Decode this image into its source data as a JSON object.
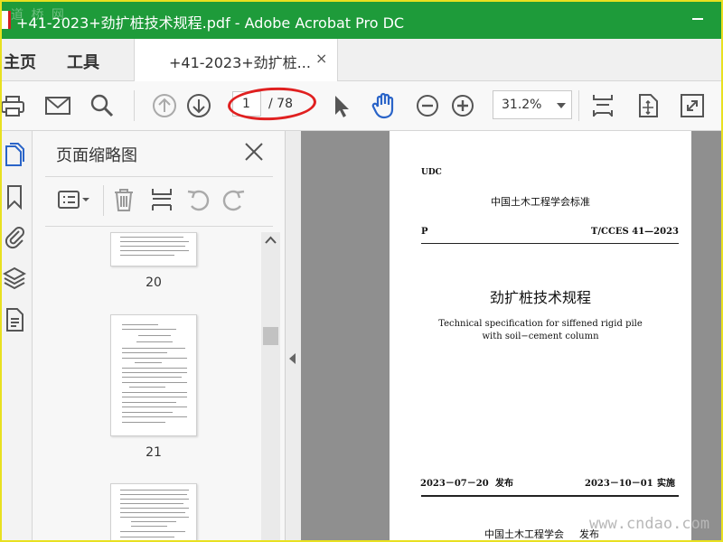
{
  "window": {
    "title": "+41-2023+劲扩桩技术规程.pdf - Adobe Acrobat Pro DC",
    "watermark_top": "道 桥 网"
  },
  "tabs": {
    "home": "主页",
    "tools": "工具",
    "document": "+41-2023+劲扩桩...",
    "close_glyph": "×"
  },
  "toolbar": {
    "page_current": "1",
    "page_total": "/ 78",
    "zoom": "31.2%",
    "icons": [
      "print-icon",
      "email-icon",
      "search-icon",
      "prev-page-icon",
      "next-page-icon",
      "select-cursor-icon",
      "hand-tool-icon",
      "zoom-out-icon",
      "zoom-in-icon",
      "fit-page-icon",
      "rotate-scroll-icon",
      "full-screen-icon"
    ],
    "highlight_color": "#e02020"
  },
  "sidebar": {
    "panel_title": "页面缩略图",
    "rail_icons": [
      "page-thumbnails-icon",
      "bookmarks-icon",
      "attachments-icon",
      "layers-icon",
      "document-properties-icon"
    ],
    "thumbnails": [
      {
        "label": "20"
      },
      {
        "label": "21"
      }
    ]
  },
  "document": {
    "udc": "UDC",
    "association_standard": "中国土木工程学会标准",
    "p_letter": "P",
    "standard_no": "T/CCES 41—2023",
    "title_cn": "劲扩桩技术规程",
    "title_en_line1": "Technical specification for siffened rigid pile",
    "title_en_line2": "with soil−cement column",
    "publish_date": "2023－07－20",
    "publish_label": "发布",
    "implement_date": "2023－10－01",
    "implement_label": "实施",
    "publisher": "中国土木工程学会",
    "publisher_action": "发布"
  },
  "watermark_bottom": "www.cndao.com",
  "colors": {
    "titlebar": "#1e9b3a",
    "frame": "#e8e020",
    "accent_blue": "#2a64c8"
  }
}
